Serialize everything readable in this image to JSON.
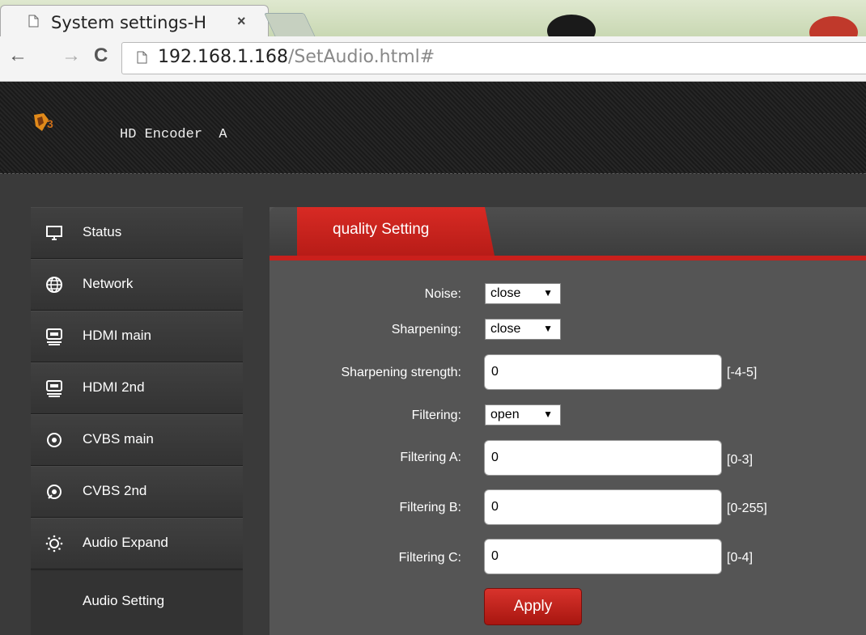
{
  "browser": {
    "tab_title": "System settings-H",
    "tab_close": "×",
    "back": "←",
    "forward": "→",
    "reload": "C",
    "url_host": "192.168.1.168",
    "url_path": "/SetAudio.html#"
  },
  "header": {
    "brand": "HD Encoder  A"
  },
  "sidebar": {
    "items": [
      {
        "label": "Status",
        "icon": "monitor-icon"
      },
      {
        "label": "Network",
        "icon": "globe-icon"
      },
      {
        "label": "HDMI main",
        "icon": "hdmi-icon"
      },
      {
        "label": "HDMI 2nd",
        "icon": "hdmi-icon"
      },
      {
        "label": "CVBS main",
        "icon": "target-icon"
      },
      {
        "label": "CVBS 2nd",
        "icon": "target-icon"
      },
      {
        "label": "Audio Expand",
        "icon": "sun-icon"
      }
    ],
    "sub_item": "Audio Setting"
  },
  "panel": {
    "tab_label": "quality Setting",
    "fields": {
      "noise": {
        "label": "Noise:",
        "value": "close"
      },
      "sharpening": {
        "label": "Sharpening:",
        "value": "close"
      },
      "sharpening_strength": {
        "label": "Sharpening strength:",
        "value": "0",
        "range": "[-4-5]"
      },
      "filtering": {
        "label": "Filtering:",
        "value": "open"
      },
      "filtering_a": {
        "label": "Filtering A:",
        "value": "0",
        "range": "[0-3]"
      },
      "filtering_b": {
        "label": "Filtering B:",
        "value": "0",
        "range": "[0-255]"
      },
      "filtering_c": {
        "label": "Filtering C:",
        "value": "0",
        "range": "[0-4]"
      }
    },
    "select_arrow": "▼",
    "apply_label": "Apply"
  },
  "colors": {
    "accent": "#c9201c",
    "header_bg": "#1f1f1f",
    "panel_bg": "#555555"
  }
}
